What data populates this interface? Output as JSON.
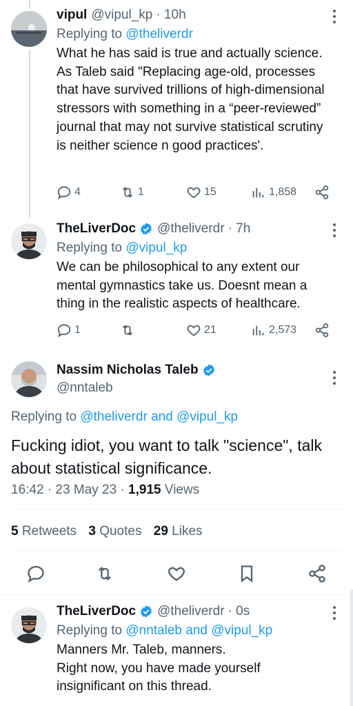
{
  "tweets": [
    {
      "name": "vipul",
      "handle": "@vipul_kp",
      "time": "· 10h",
      "replying_prefix": "Replying to",
      "replying_to": "@theliverdr",
      "text": "What he has said is true and actually science. As Taleb said \"Replacing age-old, processes that have survived trillions of high-dimensional stressors with something in a “peer-reviewed” journal that may not survive statistical scrutiny is neither science n good practices'.",
      "replies": "4",
      "retweets": "1",
      "likes": "15",
      "views": "1,858"
    },
    {
      "name": "TheLiverDoc",
      "handle": "@theliverdr",
      "time": "· 7h",
      "replying_prefix": "Replying to",
      "replying_to": "@vipul_kp",
      "text": "We can be philosophical to any extent our mental gymnastics take us. Doesnt mean a thing in the realistic aspects of healthcare.",
      "replies": "1",
      "retweets": "",
      "likes": "21",
      "views": "2,573"
    }
  ],
  "main_tweet": {
    "name": "Nassim Nicholas Taleb",
    "handle": "@nntaleb",
    "replying_prefix": "Replying to",
    "replying_to_1": "@theliverdr",
    "replying_and": "and",
    "replying_to_2": "@vipul_kp",
    "text": "Fucking idiot, you want to talk \"science\", talk about statistical significance.",
    "time": "16:42 · 23 May 23 ·",
    "views_count": "1,915",
    "views_label": "Views",
    "retweets_count": "5",
    "retweets_label": "Retweets",
    "quotes_count": "3",
    "quotes_label": "Quotes",
    "likes_count": "29",
    "likes_label": "Likes"
  },
  "reply": {
    "name": "TheLiverDoc",
    "handle": "@theliverdr",
    "time": "· 0s",
    "replying_prefix": "Replying to",
    "replying_to_1": "@nntaleb",
    "replying_and": "and",
    "replying_to_2": "@vipul_kp",
    "text_line1": "Manners Mr. Taleb, manners.",
    "text_line2": "Right now, you have made yourself insignificant on this thread."
  },
  "colors": {
    "accent": "#1d9bf0",
    "secondary_text": "#536471",
    "primary_text": "#0f1419"
  }
}
